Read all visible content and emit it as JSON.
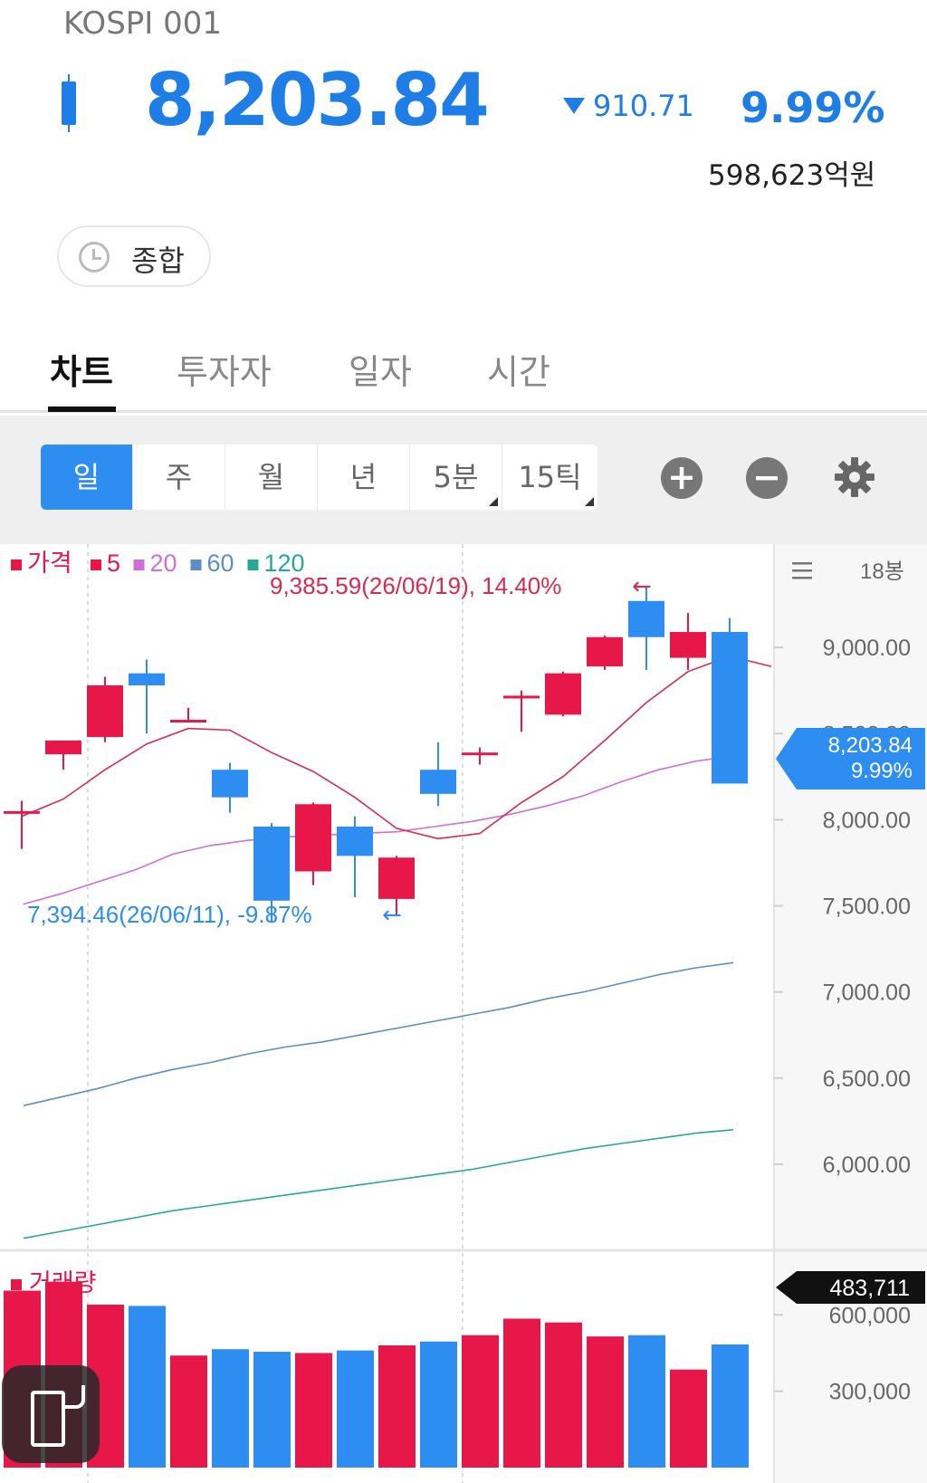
{
  "header": {
    "ticker": "KOSPI 001",
    "price": "8,203.84",
    "change": "910.71",
    "change_pct": "9.99%",
    "trade_amount": "598,623억원",
    "direction": "down",
    "accent_color": "#1e7ee6"
  },
  "session_chip": {
    "label": "종합",
    "icon": "clock-icon"
  },
  "tabs": [
    {
      "label": "차트",
      "active": true
    },
    {
      "label": "투자자",
      "active": false
    },
    {
      "label": "일자",
      "active": false
    },
    {
      "label": "시간",
      "active": false
    }
  ],
  "periods": [
    {
      "label": "일",
      "active": true
    },
    {
      "label": "주"
    },
    {
      "label": "월"
    },
    {
      "label": "년"
    },
    {
      "label": "5분",
      "has_menu": true
    },
    {
      "label": "15틱",
      "has_menu": true
    }
  ],
  "toolbar_icons": [
    "zoom-in-icon",
    "zoom-out-icon",
    "gear-icon"
  ],
  "chart_data": [
    {
      "type": "candlestick",
      "legend": [
        {
          "label": "가격",
          "color": "#e8174a"
        },
        {
          "label": "5",
          "color": "#e8174a"
        },
        {
          "label": "20",
          "color": "#cf6fd6"
        },
        {
          "label": "60",
          "color": "#5b8fc2"
        },
        {
          "label": "120",
          "color": "#25a89a"
        }
      ],
      "bar_count_label": "18봉",
      "y_ticks": [
        "9,000.00",
        "8,500.00",
        "8,000.00",
        "7,500.00",
        "7,000.00",
        "6,500.00",
        "6,000.00"
      ],
      "y_tick_values": [
        9000,
        8500,
        8000,
        7500,
        7000,
        6500,
        6000
      ],
      "ylim": [
        5500,
        9600
      ],
      "current_price_label": "8,203.84",
      "current_change_label": "9.99%",
      "high_annotation": "9,385.59(26/06/19), 14.40%",
      "low_annotation": "7,394.46(26/06/11), -9.87%",
      "candles": [
        {
          "o": 8040,
          "h": 8110,
          "l": 7830,
          "c": 8050
        },
        {
          "o": 8380,
          "h": 8430,
          "l": 8290,
          "c": 8460
        },
        {
          "o": 8480,
          "h": 8830,
          "l": 8450,
          "c": 8780
        },
        {
          "o": 8850,
          "h": 8930,
          "l": 8500,
          "c": 8780
        },
        {
          "o": 8580,
          "h": 8650,
          "l": 8570,
          "c": 8580
        },
        {
          "o": 8290,
          "h": 8330,
          "l": 8040,
          "c": 8130
        },
        {
          "o": 7960,
          "h": 7980,
          "l": 7410,
          "c": 7530
        },
        {
          "o": 7700,
          "h": 8100,
          "l": 7620,
          "c": 8090
        },
        {
          "o": 7960,
          "h": 8020,
          "l": 7550,
          "c": 7790
        },
        {
          "o": 7540,
          "h": 7790,
          "l": 7440,
          "c": 7780
        },
        {
          "o": 8290,
          "h": 8450,
          "l": 8080,
          "c": 8150
        },
        {
          "o": 8380,
          "h": 8420,
          "l": 8320,
          "c": 8390
        },
        {
          "o": 8720,
          "h": 8750,
          "l": 8510,
          "c": 8720
        },
        {
          "o": 8610,
          "h": 8860,
          "l": 8600,
          "c": 8850
        },
        {
          "o": 8890,
          "h": 9070,
          "l": 8870,
          "c": 9060
        },
        {
          "o": 9270,
          "h": 9350,
          "l": 8870,
          "c": 9060
        },
        {
          "o": 8940,
          "h": 9200,
          "l": 8870,
          "c": 9090
        },
        {
          "o": 9090,
          "h": 9170,
          "l": 8210,
          "c": 8210
        }
      ],
      "ma5": [
        8020,
        8120,
        8290,
        8440,
        8530,
        8520,
        8390,
        8280,
        8130,
        7950,
        7890,
        7920,
        8100,
        8250,
        8460,
        8680,
        8860,
        8950,
        8890
      ],
      "ma20": [
        7510,
        7570,
        7640,
        7710,
        7800,
        7850,
        7880,
        7900,
        7910,
        7920,
        7930,
        7960,
        7990,
        8030,
        8080,
        8140,
        8220,
        8290,
        8340,
        8370
      ],
      "ma60": [
        6340,
        6390,
        6440,
        6500,
        6550,
        6590,
        6640,
        6680,
        6710,
        6750,
        6790,
        6830,
        6870,
        6910,
        6960,
        7000,
        7050,
        7100,
        7140,
        7170
      ],
      "ma120": [
        5570,
        5610,
        5650,
        5690,
        5730,
        5760,
        5790,
        5820,
        5850,
        5880,
        5910,
        5940,
        5970,
        6010,
        6050,
        6090,
        6120,
        6150,
        6180,
        6200
      ]
    },
    {
      "type": "bar",
      "legend": [
        {
          "label": "거래량",
          "color": "#e8174a"
        }
      ],
      "y_ticks": [
        "600,000",
        "300,000"
      ],
      "y_tick_values": [
        600000,
        300000
      ],
      "ylim": [
        0,
        800000
      ],
      "current_value_label": "483,711",
      "values": [
        695000,
        730000,
        640000,
        635000,
        440000,
        465000,
        455000,
        450000,
        460000,
        480000,
        495000,
        520000,
        585000,
        570000,
        515000,
        520000,
        385000,
        483711
      ],
      "colors": [
        "up",
        "up",
        "up",
        "down",
        "up",
        "down",
        "down",
        "up",
        "down",
        "up",
        "down",
        "up",
        "up",
        "up",
        "up",
        "down",
        "up",
        "down"
      ]
    }
  ],
  "up_color": "#e8174a",
  "down_color": "#2d8df0",
  "floating_button": {
    "icon": "screen-rotate-icon"
  }
}
